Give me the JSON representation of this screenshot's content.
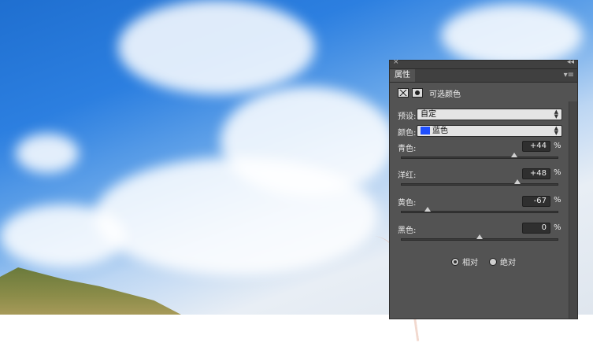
{
  "panel": {
    "tab_label": "属性",
    "header_title": "可选颜色",
    "preset_label": "预设:",
    "preset_value": "自定",
    "color_label": "颜色:",
    "color_value": "蓝色",
    "color_swatch": "#1f4fff",
    "sliders": [
      {
        "label": "青色:",
        "value": "+44",
        "unit": "%",
        "fraction": 0.72
      },
      {
        "label": "洋红:",
        "value": "+48",
        "unit": "%",
        "fraction": 0.74
      },
      {
        "label": "黄色:",
        "value": "-67",
        "unit": "%",
        "fraction": 0.165
      },
      {
        "label": "黑色:",
        "value": "0",
        "unit": "%",
        "fraction": 0.5
      }
    ],
    "radio_relative": "相对",
    "radio_absolute": "绝对",
    "close_icon": "close-icon",
    "collapse_icon": "collapse-icon",
    "menu_icon": "menu-icon"
  }
}
